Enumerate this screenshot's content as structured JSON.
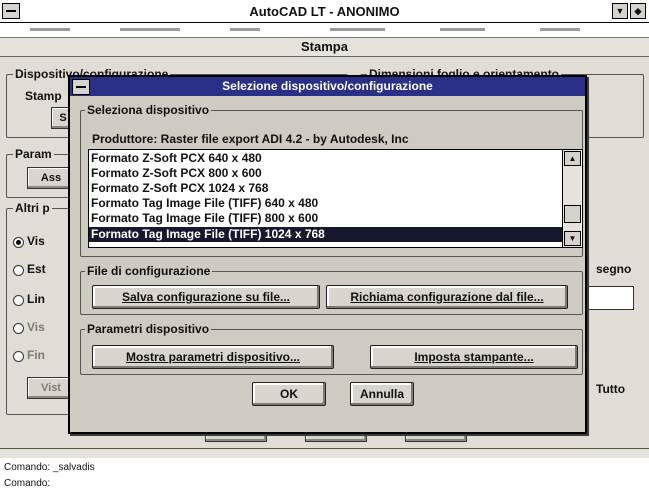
{
  "window": {
    "title": "AutoCAD LT - ANONIMO"
  },
  "stampa": {
    "title": "Stampa",
    "group_device": "Dispositivo/configurazione",
    "group_sheet": "Dimensioni foglio e orientamento",
    "stamp_label": "Stamp",
    "btn_s": "S",
    "group_params": "Param",
    "btn_ass": "Ass",
    "group_other": "Altri p",
    "radio_vis": "Vis",
    "radio_est": "Est",
    "radio_lin": "Lin",
    "radio_vis2": "Vis",
    "radio_fin": "Fin",
    "btn_vista": "Vist",
    "right_segno": "segno",
    "right_tutto": "Tutto"
  },
  "command": {
    "line1": "Comando: _salvadis",
    "line2": "Comando:"
  },
  "dialog": {
    "title": "Selezione dispositivo/configurazione",
    "select_group": "Seleziona dispositivo",
    "manufacturer": "Produttore: Raster file export ADI 4.2 - by Autodesk, Inc",
    "devices": [
      "Formato Z-Soft PCX 640 x 480",
      "Formato Z-Soft PCX 800 x 600",
      "Formato Z-Soft PCX 1024 x 768",
      "Formato Tag Image File (TIFF) 640 x 480",
      "Formato Tag Image File (TIFF) 800 x 600",
      "Formato Tag Image File (TIFF) 1024 x 768"
    ],
    "selected_device": "Formato Tag Image File (TIFF) 1024 x 768",
    "config_group": "File di configurazione",
    "save_config": "Salva configurazione su file...",
    "load_config": "Richiama configurazione dal file...",
    "params_group": "Parametri dispositivo",
    "show_params": "Mostra parametri dispositivo...",
    "set_printer": "Imposta stampante...",
    "ok": "OK",
    "cancel": "Annulla"
  },
  "icons": {
    "system_menu": "system-menu-icon",
    "scroll_up": "scroll-up-icon",
    "scroll_down": "scroll-down-icon"
  },
  "colors": {
    "dialog_title_bg": "#2a2f87",
    "selection_bg": "#16182e"
  }
}
